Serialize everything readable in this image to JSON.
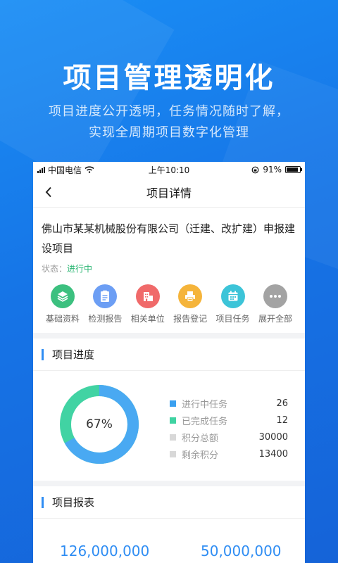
{
  "hero": {
    "title": "项目管理透明化",
    "subtitle_line1": "项目进度公开透明，任务情况随时了解，",
    "subtitle_line2": "实现全周期项目数字化管理"
  },
  "statusbar": {
    "carrier": "中国电信",
    "time": "上午10:10",
    "battery": "91%",
    "battery_level": 0.91
  },
  "nav": {
    "title": "项目详情",
    "back_icon": "chevron-left-icon"
  },
  "project": {
    "name": "佛山市某某机械股份有限公司（迁建、改扩建）申报建设项目",
    "status_label": "状态：",
    "status_value": "进行中",
    "status_color": "#2bb673"
  },
  "icons": [
    {
      "label": "基础资料",
      "icon": "layers-icon",
      "color": "#3cc07f"
    },
    {
      "label": "检测报告",
      "icon": "document-icon",
      "color": "#6c9ef4"
    },
    {
      "label": "相关单位",
      "icon": "building-icon",
      "color": "#f06a6a"
    },
    {
      "label": "报告登记",
      "icon": "printer-icon",
      "color": "#f5b43a"
    },
    {
      "label": "项目任务",
      "icon": "calendar-icon",
      "color": "#3cc4d8"
    },
    {
      "label": "展开全部",
      "icon": "more-icon",
      "color": "#a3a3a3"
    }
  ],
  "progress": {
    "section_title": "项目进度",
    "percent_label": "67%",
    "percent": 0.67,
    "colors": {
      "done": "#49a9f2",
      "remain": "#41d3a3"
    },
    "legend": [
      {
        "label": "进行中任务",
        "value": "26",
        "color": "#3aa0f0"
      },
      {
        "label": "已完成任务",
        "value": "12",
        "color": "#3fd3a2"
      },
      {
        "label": "积分总额",
        "value": "30000",
        "color": "#d8d8d8"
      },
      {
        "label": "剩余积分",
        "value": "13400",
        "color": "#d8d8d8"
      }
    ]
  },
  "report": {
    "section_title": "项目报表",
    "values": [
      "126,000,000",
      "50,000,000"
    ]
  }
}
